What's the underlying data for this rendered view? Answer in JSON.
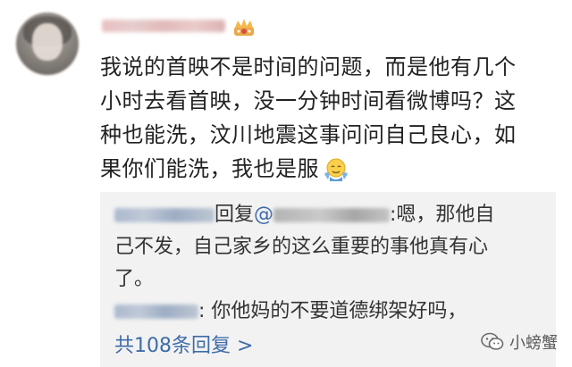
{
  "post": {
    "comment_lines": [
      "我说的首映不是时间的问题，而是他有几个",
      "小时去看首映，没一分钟时间看微博吗？这",
      "种也能洗，汶川地震这事问问自己良心，如",
      "果你们能洗，我也是服"
    ],
    "emoji_icon": "shrug-emoji-icon",
    "vip_icon": "crown-badge-icon"
  },
  "replies": [
    {
      "reply_label": "回复",
      "at_sign": "@",
      "text_lines": [
        ":嗯，那他自",
        "己不发，自己家乡的这么重要的事他真有心",
        "了。"
      ]
    },
    {
      "text": ": 你他妈的不要道德绑架好吗，"
    }
  ],
  "more_replies_label": "共108条回复 >",
  "watermark": {
    "text": "小螃蟹",
    "icon": "wechat-icon"
  },
  "colors": {
    "link": "#3f6ca8",
    "text": "#222222",
    "reply_bg": "#f2f2f2"
  }
}
